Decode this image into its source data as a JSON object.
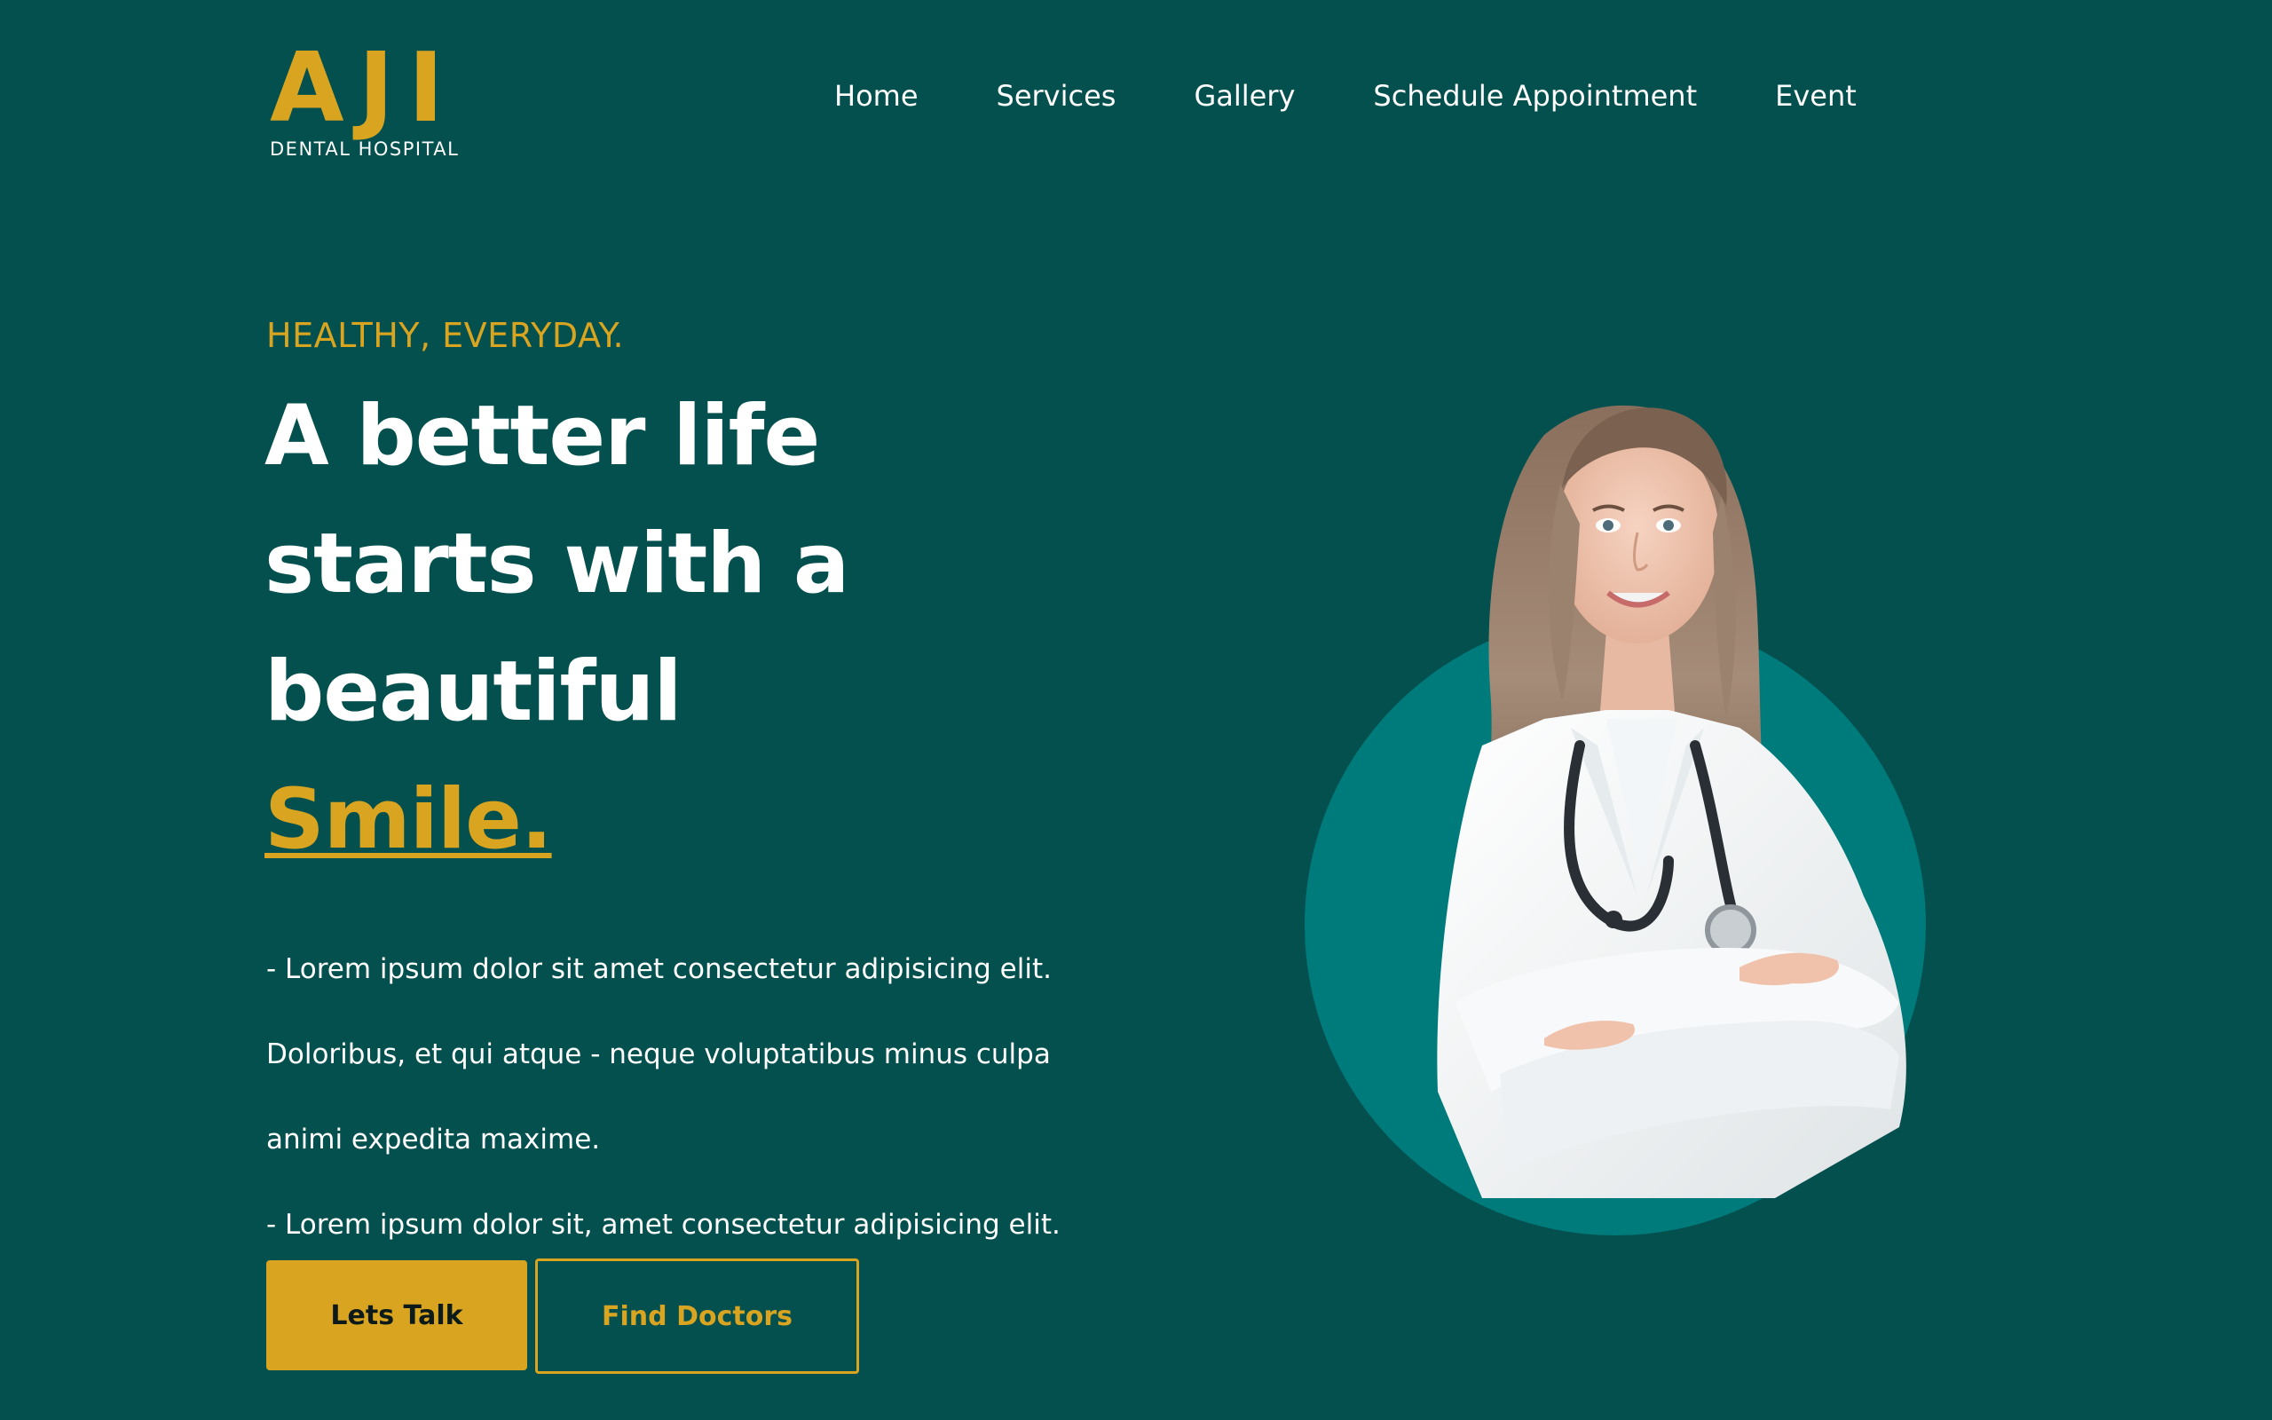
{
  "brand": {
    "mark": "AJI",
    "subtitle": "DENTAL HOSPITAL"
  },
  "nav": {
    "items": [
      {
        "label": "Home"
      },
      {
        "label": "Services"
      },
      {
        "label": "Gallery"
      },
      {
        "label": "Schedule Appointment"
      },
      {
        "label": "Event"
      }
    ]
  },
  "hero": {
    "eyebrow": "HEALTHY, EVERYDAY.",
    "headline_lines": [
      "A better life",
      "starts with a",
      "beautiful"
    ],
    "headline_accent": "Smile.",
    "description_lines": [
      "- Lorem ipsum dolor sit amet consectetur adipisicing elit.",
      "Doloribus, et qui atque - neque voluptatibus minus culpa",
      "animi expedita maxime.",
      "- Lorem ipsum dolor sit, amet consectetur adipisicing elit."
    ],
    "primary_button": "Lets Talk",
    "secondary_button": "Find Doctors"
  },
  "colors": {
    "background": "#03504f",
    "accent": "#d9a521",
    "circle": "#007b7b",
    "text": "#ffffff"
  },
  "icons": {
    "hero_image": "doctor-portrait-image"
  }
}
